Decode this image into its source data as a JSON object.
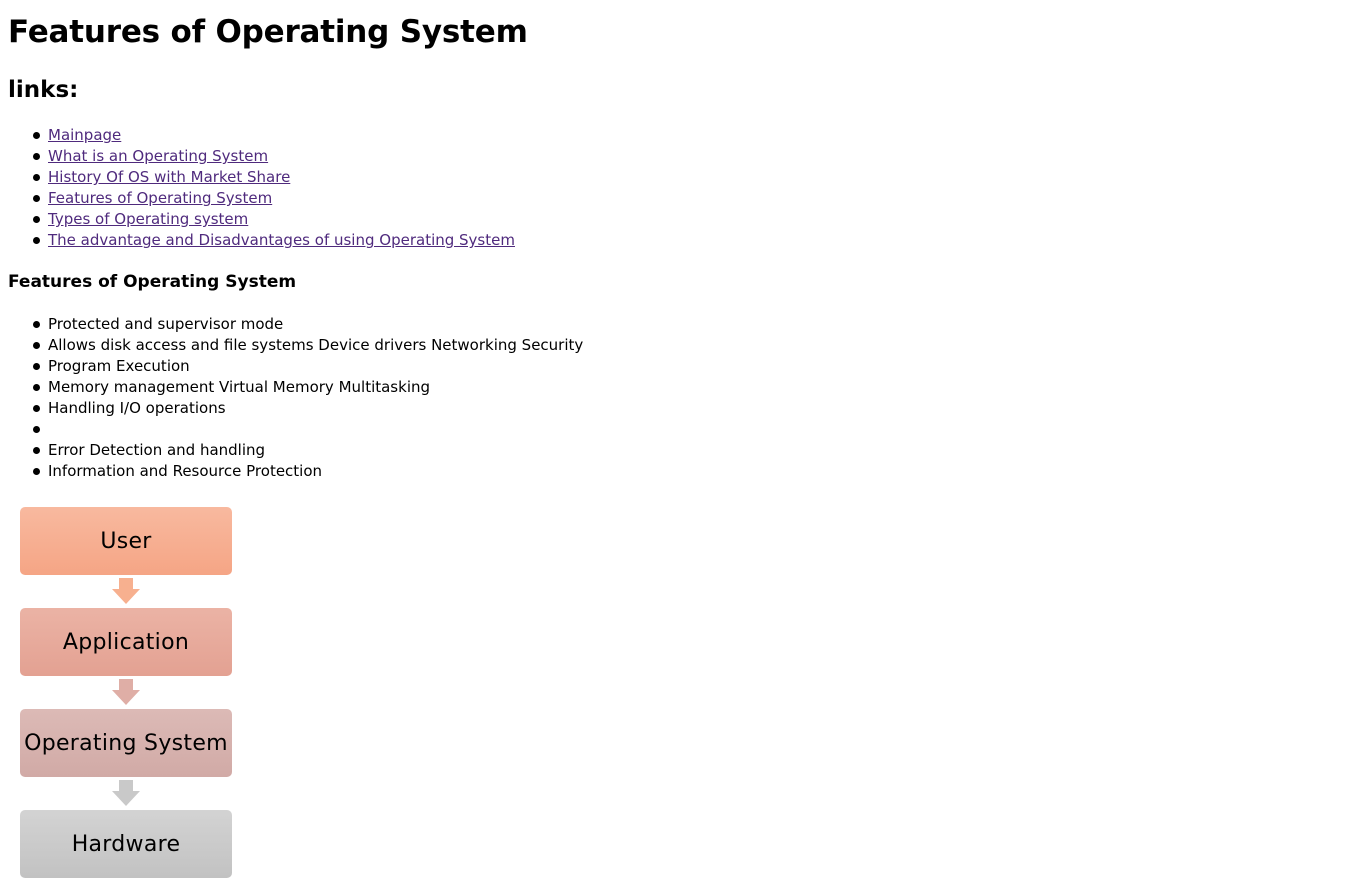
{
  "page": {
    "title": "Features of Operating System",
    "links_heading": "links:",
    "links": [
      {
        "label": "Mainpage"
      },
      {
        "label": "What is an Operating System"
      },
      {
        "label": "History Of OS with Market Share"
      },
      {
        "label": "Features of Operating System"
      },
      {
        "label": "Types of Operating system"
      },
      {
        "label": "The advantage and Disadvantages of using Operating System"
      }
    ],
    "features_heading": "Features of Operating System",
    "features": [
      "Protected and supervisor mode",
      "Allows disk access and file systems Device drivers Networking Security",
      "Program Execution",
      "Memory management Virtual Memory Multitasking",
      "Handling I/O operations",
      "",
      "Error Detection and handling",
      "Information and Resource Protection"
    ]
  },
  "diagram": {
    "layers": [
      {
        "label": "User",
        "color": "#f6ad8e"
      },
      {
        "label": "Application",
        "color": "#e7aa9b"
      },
      {
        "label": "Operating System",
        "color": "#d6b2ae"
      },
      {
        "label": "Hardware",
        "color": "#cacaca"
      }
    ],
    "arrow_colors": [
      "#f7b08f",
      "#dfaea6",
      "#c9c9c9"
    ]
  },
  "colors": {
    "link": "#4f2a7d",
    "text": "#000000",
    "background": "#ffffff"
  }
}
